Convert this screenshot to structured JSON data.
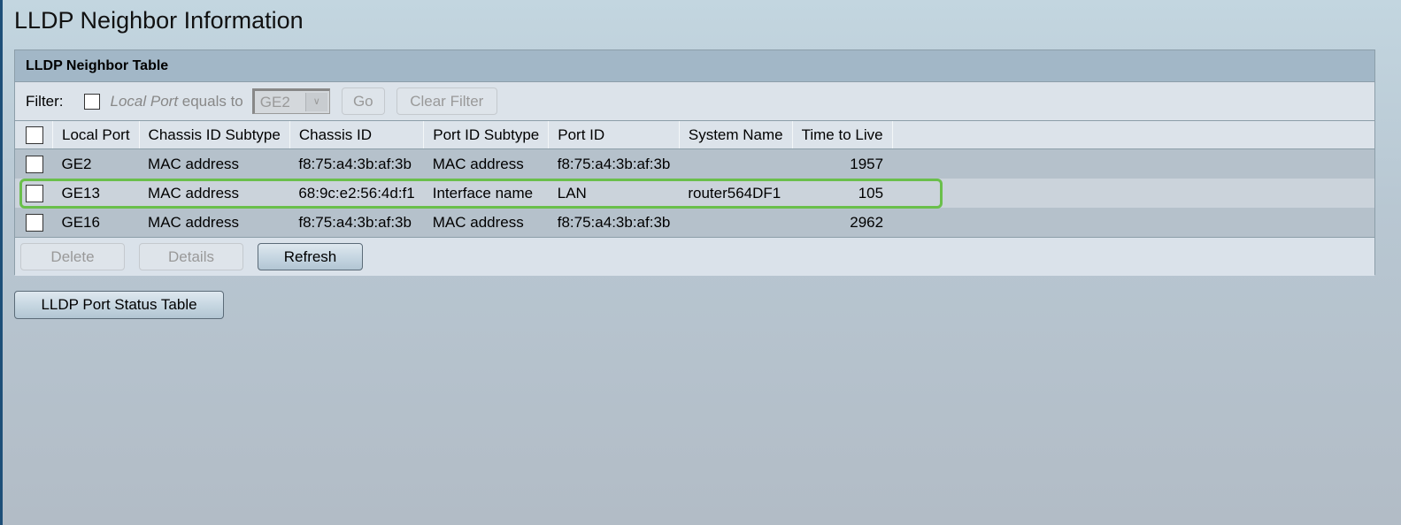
{
  "page": {
    "title": "LLDP Neighbor Information"
  },
  "panel": {
    "title": "LLDP Neighbor Table",
    "filter": {
      "label": "Filter:",
      "field_italic": "Local Port",
      "field_rest": " equals to",
      "select_value": "GE2",
      "go_label": "Go",
      "clear_label": "Clear Filter"
    },
    "columns": [
      "Local Port",
      "Chassis ID Subtype",
      "Chassis ID",
      "Port ID Subtype",
      "Port ID",
      "System Name",
      "Time to Live"
    ],
    "rows": [
      {
        "local_port": "GE2",
        "chassis_id_subtype": "MAC address",
        "chassis_id": "f8:75:a4:3b:af:3b",
        "port_id_subtype": "MAC address",
        "port_id": "f8:75:a4:3b:af:3b",
        "system_name": "",
        "ttl": "1957",
        "highlighted": false
      },
      {
        "local_port": "GE13",
        "chassis_id_subtype": "MAC address",
        "chassis_id": "68:9c:e2:56:4d:f1",
        "port_id_subtype": "Interface name",
        "port_id": "LAN",
        "system_name": "router564DF1",
        "ttl": "105",
        "highlighted": true
      },
      {
        "local_port": "GE16",
        "chassis_id_subtype": "MAC address",
        "chassis_id": "f8:75:a4:3b:af:3b",
        "port_id_subtype": "MAC address",
        "port_id": "f8:75:a4:3b:af:3b",
        "system_name": "",
        "ttl": "2962",
        "highlighted": false
      }
    ],
    "actions": {
      "delete_label": "Delete",
      "details_label": "Details",
      "refresh_label": "Refresh"
    }
  },
  "port_status_button": "LLDP Port Status Table",
  "colors": {
    "highlight": "#6abf4b",
    "header_bar": "#a2b7c7"
  }
}
